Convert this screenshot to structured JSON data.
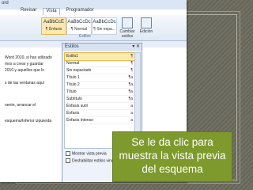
{
  "ribbon": {
    "app_title": "ord",
    "tabs": [
      "Revisar",
      "Vista",
      "Programador"
    ],
    "styles": [
      {
        "preview": "AaBbCcDc",
        "name": "¶ Normal"
      },
      {
        "preview": "AaBbCcDc",
        "name": "¶ Sin espa..."
      }
    ],
    "selected_style": {
      "preview": "AaBbCcE",
      "name": "¶ Énfasis"
    },
    "change_styles": "Cambiar estilos",
    "edit": "Edición",
    "group_styles": "Estilos"
  },
  "document": {
    "lines": [
      "Word 2010, si has utilizado",
      "mos a crear y guardar",
      "2010 y aquellos que lo",
      "",
      "s de las ventanas aquí",
      "",
      "nente, arrancar el",
      "",
      "esquema/Inferior izquierda"
    ]
  },
  "styles_pane": {
    "title": "Estilos",
    "items": [
      {
        "label": "Estilo1",
        "mark": "¶",
        "selected": true
      },
      {
        "label": "Normal",
        "mark": "¶"
      },
      {
        "label": "Sin espaciado",
        "mark": "¶"
      },
      {
        "label": "Título 1",
        "mark": "¶a"
      },
      {
        "label": "Título 2",
        "mark": "¶a"
      },
      {
        "label": "Título",
        "mark": "¶a"
      },
      {
        "label": "Subtítulo",
        "mark": "¶a"
      },
      {
        "label": "Énfasis sutil",
        "mark": "a"
      },
      {
        "label": "Énfasis",
        "mark": "a"
      },
      {
        "label": "Énfasis intenso",
        "mark": "a"
      }
    ],
    "show_preview": "Mostrar vista previa",
    "disable_linked": "Deshabilitar estilos vinculados"
  },
  "callout": {
    "text": "Se le da clic para muestra la vista previa del esquema"
  },
  "colors": {
    "callout_bg": "#7e9a2c",
    "highlight": "#fde9b0"
  }
}
